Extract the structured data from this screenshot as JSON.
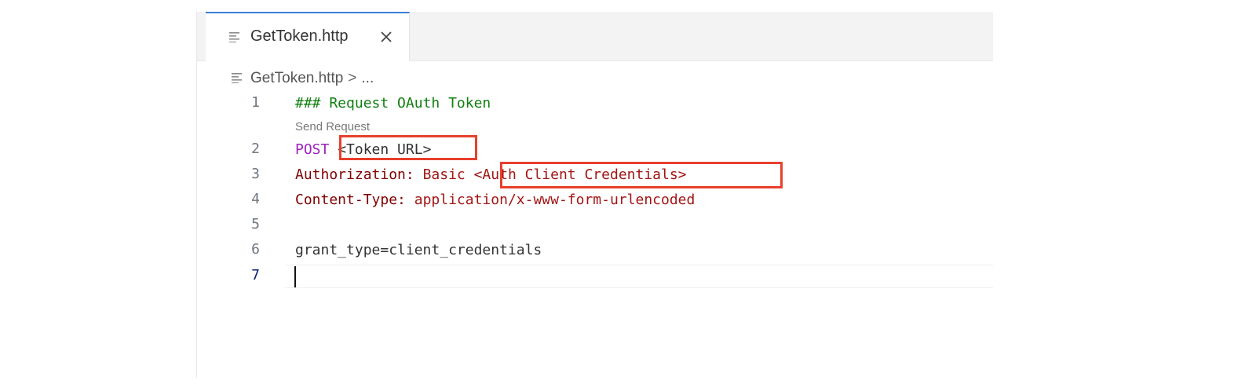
{
  "tab": {
    "label": "GetToken.http",
    "file_icon": "file-lines-icon",
    "close_icon": "close-icon"
  },
  "breadcrumb": {
    "file": "GetToken.http",
    "separator": ">",
    "rest": "..."
  },
  "codelens": {
    "send_request": "Send Request"
  },
  "lines": [
    {
      "number": "1",
      "comment": "### Request OAuth Token"
    },
    {
      "number": "2",
      "method": "POST",
      "url": "<Token URL>"
    },
    {
      "number": "3",
      "header_name": "Authorization:",
      "header_value": "Basic",
      "placeholder": "<Auth Client Credentials>"
    },
    {
      "number": "4",
      "header_name": "Content-Type:",
      "header_value": "application/x-www-form-urlencoded"
    },
    {
      "number": "5"
    },
    {
      "number": "6",
      "body": "grant_type=client_credentials"
    },
    {
      "number": "7"
    }
  ],
  "colors": {
    "highlight_box": "#e8402c",
    "tab_accent": "#3b7fd6"
  }
}
